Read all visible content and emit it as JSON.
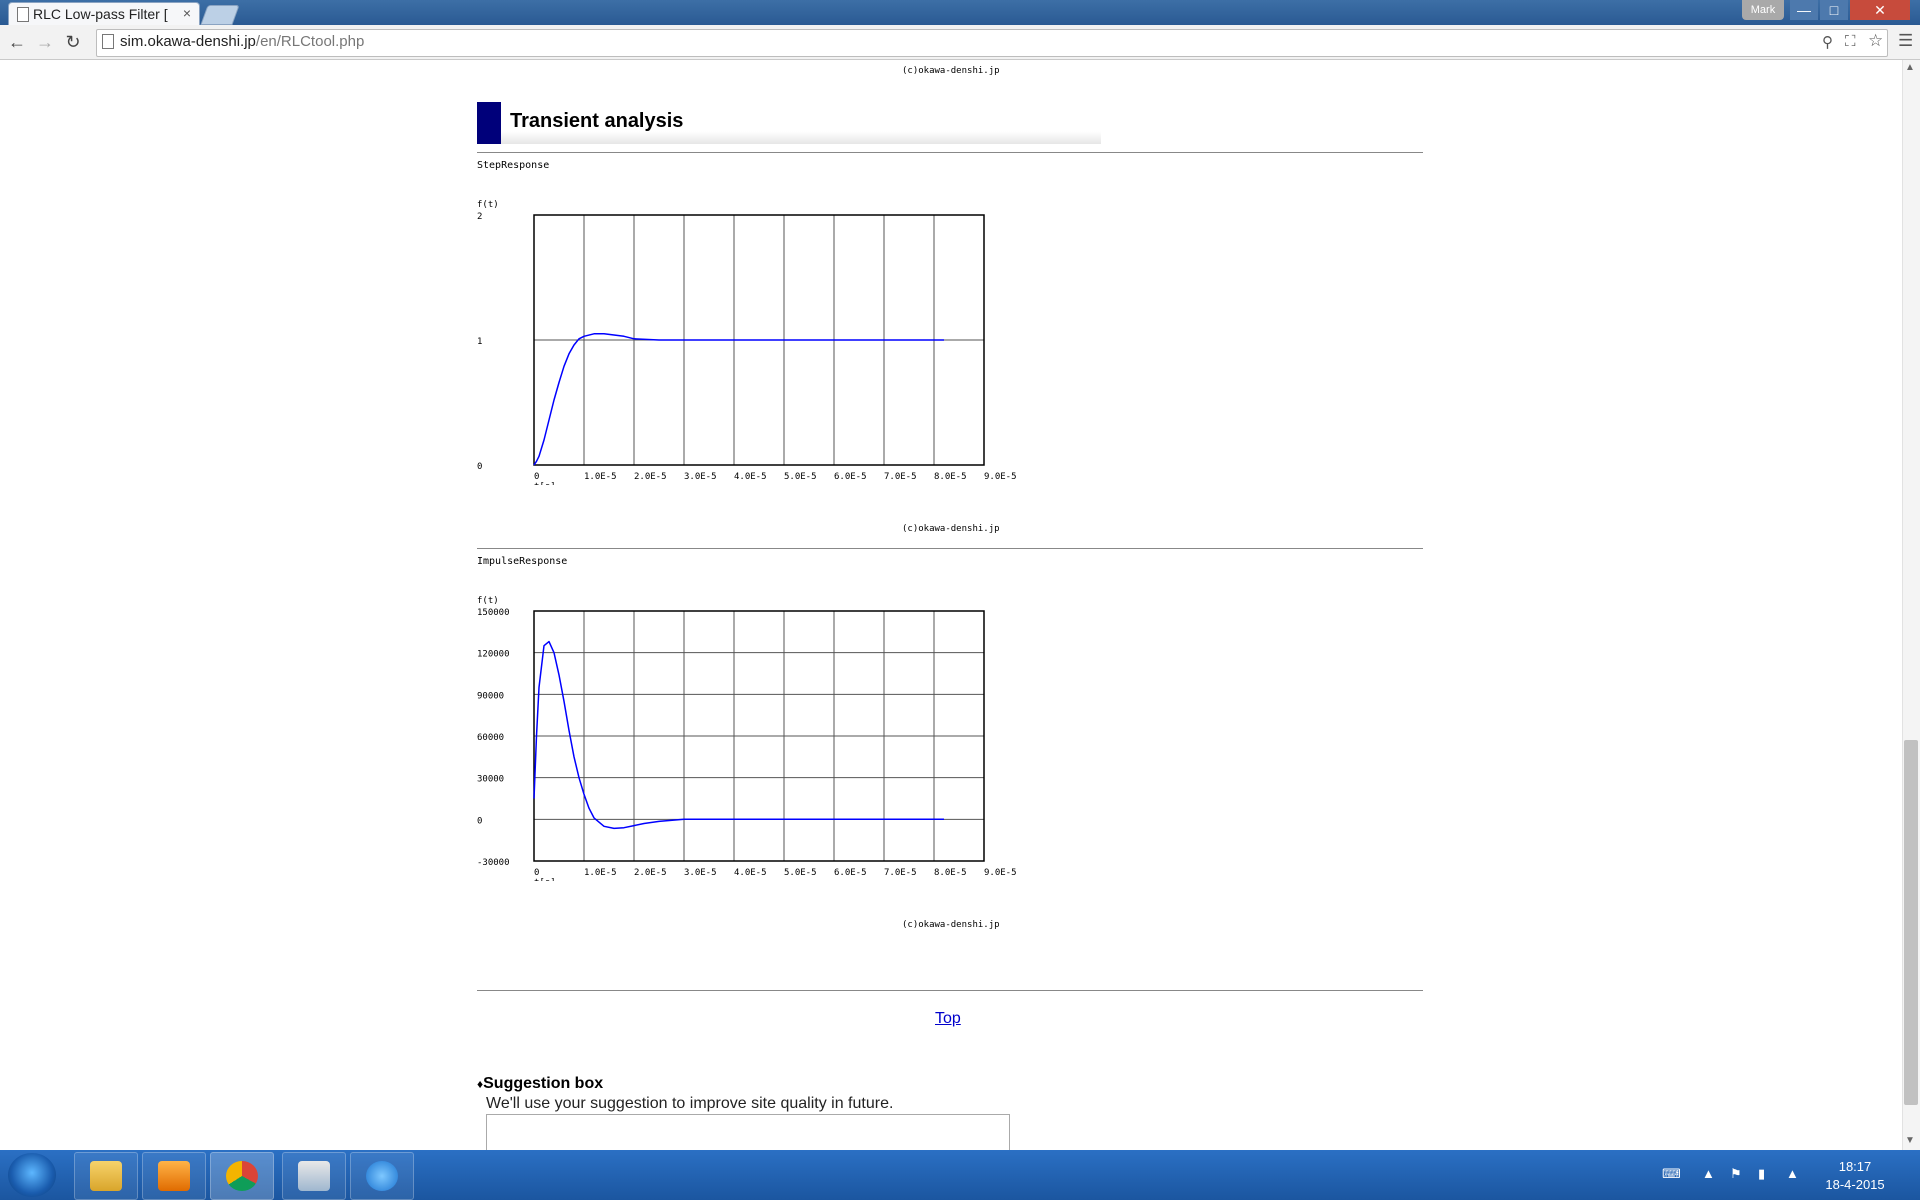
{
  "browser": {
    "tab_title": "RLC Low-pass Filter [",
    "tab_close": "×",
    "profile_name": "Mark",
    "url_host": "sim.okawa-denshi.jp",
    "url_path": "/en/RLCtool.php"
  },
  "page": {
    "copyright": "(c)okawa-denshi.jp",
    "section_title": "Transient analysis",
    "top_link": "Top",
    "suggestion": {
      "title": "Suggestion box",
      "text": "We'll use your suggestion to improve site quality in future."
    }
  },
  "chart_data": [
    {
      "type": "line",
      "title": "StepResponse",
      "ylabel": "f(t)",
      "xlabel": "t[s]",
      "ylim": [
        0,
        2
      ],
      "xlim": [
        0,
        9e-05
      ],
      "ytick_labels": [
        "2",
        "1",
        "0"
      ],
      "xtick_labels": [
        "0",
        "1.0E-5",
        "2.0E-5",
        "3.0E-5",
        "4.0E-5",
        "5.0E-5",
        "6.0E-5",
        "7.0E-5",
        "8.0E-5",
        "9.0E-5"
      ],
      "grid": true,
      "series": [
        {
          "color": "#0000ff",
          "x": [
            0,
            5e-07,
            1e-06,
            2e-06,
            3e-06,
            4e-06,
            5e-06,
            6e-06,
            7e-06,
            8e-06,
            9e-06,
            1e-05,
            1.2e-05,
            1.4e-05,
            1.6e-05,
            1.8e-05,
            2e-05,
            2.5e-05,
            3e-05,
            4e-05,
            5e-05,
            6e-05,
            7e-05,
            8.2e-05
          ],
          "y": [
            0,
            0.03,
            0.07,
            0.2,
            0.36,
            0.52,
            0.66,
            0.79,
            0.89,
            0.96,
            1.01,
            1.03,
            1.05,
            1.05,
            1.04,
            1.03,
            1.01,
            1.0,
            1.0,
            1.0,
            1.0,
            1.0,
            1.0,
            1.0
          ]
        }
      ]
    },
    {
      "type": "line",
      "title": "ImpulseResponse",
      "ylabel": "f(t)",
      "xlabel": "t[s]",
      "ylim": [
        -30000,
        150000
      ],
      "xlim": [
        0,
        9e-05
      ],
      "ytick_labels": [
        "150000",
        "120000",
        "90000",
        "60000",
        "30000",
        "0",
        "-30000"
      ],
      "xtick_labels": [
        "0",
        "1.0E-5",
        "2.0E-5",
        "3.0E-5",
        "4.0E-5",
        "5.0E-5",
        "6.0E-5",
        "7.0E-5",
        "8.0E-5",
        "9.0E-5"
      ],
      "grid": true,
      "series": [
        {
          "color": "#0000ff",
          "x": [
            0,
            5e-07,
            1e-06,
            2e-06,
            3e-06,
            4e-06,
            5e-06,
            6e-06,
            7e-06,
            8e-06,
            9e-06,
            1e-05,
            1.1e-05,
            1.2e-05,
            1.4e-05,
            1.6e-05,
            1.8e-05,
            2e-05,
            2.2e-05,
            2.5e-05,
            3e-05,
            4e-05,
            5e-05,
            6e-05,
            7e-05,
            8.2e-05
          ],
          "y": [
            15000,
            60000,
            95000,
            125000,
            128000,
            120000,
            104000,
            85000,
            64000,
            45000,
            30000,
            18000,
            8000,
            1000,
            -5000,
            -6500,
            -6000,
            -4500,
            -3000,
            -1500,
            0,
            0,
            0,
            0,
            0,
            0
          ]
        }
      ]
    }
  ],
  "taskbar": {
    "time": "18:17",
    "date": "18-4-2015"
  }
}
